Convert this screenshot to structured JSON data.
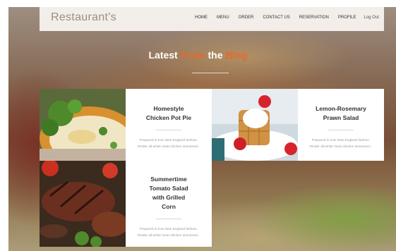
{
  "site": {
    "logo": "Restaurant's"
  },
  "nav": {
    "items": [
      "HOME",
      "MENU",
      "ORDER",
      "CONTACT US",
      "RESERVATION",
      "PROFILE"
    ],
    "logout": "Log Out"
  },
  "section": {
    "title_part1": "Latest",
    "title_part2": "From",
    "title_part3": "the",
    "title_part4": "Blog"
  },
  "posts": [
    {
      "title_line1": "Homestyle",
      "title_line2": "Chicken Pot Pie",
      "excerpt": "Prepared in true New England fashion. Tender all-white meat chicken simmered..."
    },
    {
      "title_line1": "Lemon-Rosemary",
      "title_line2": "Prawn Salad",
      "excerpt": "Prepared in true New England fashion. Tender all-white meat chicken simmered..."
    },
    {
      "title_line1": "Summertime",
      "title_line2": "Tomato Salad",
      "title_line3": "with Grilled",
      "title_line4": "Corn",
      "excerpt": "Prepared in true New England fashion. Tender all-white meat chicken simmered..."
    }
  ],
  "colors": {
    "accent": "#e8672b",
    "header_bg": "#faf6f2",
    "logo": "#9b8f86"
  }
}
